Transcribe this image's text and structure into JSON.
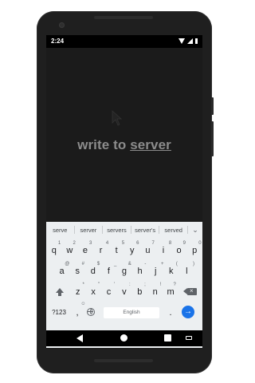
{
  "status": {
    "time": "2:24"
  },
  "app": {
    "text_plain": "write to ",
    "text_underlined": "server"
  },
  "keyboard": {
    "suggestions": [
      "serve",
      "server",
      "servers",
      "server's",
      "served"
    ],
    "row1": [
      {
        "k": "q",
        "h": "1"
      },
      {
        "k": "w",
        "h": "2"
      },
      {
        "k": "e",
        "h": "3"
      },
      {
        "k": "r",
        "h": "4"
      },
      {
        "k": "t",
        "h": "5"
      },
      {
        "k": "y",
        "h": "6"
      },
      {
        "k": "u",
        "h": "7"
      },
      {
        "k": "i",
        "h": "8"
      },
      {
        "k": "o",
        "h": "9"
      },
      {
        "k": "p",
        "h": "0"
      }
    ],
    "row2": [
      {
        "k": "a",
        "h": "@"
      },
      {
        "k": "s",
        "h": "#"
      },
      {
        "k": "d",
        "h": "$"
      },
      {
        "k": "f",
        "h": "_"
      },
      {
        "k": "g",
        "h": "&"
      },
      {
        "k": "h",
        "h": "-"
      },
      {
        "k": "j",
        "h": "+"
      },
      {
        "k": "k",
        "h": "("
      },
      {
        "k": "l",
        "h": ")"
      }
    ],
    "row3": [
      {
        "k": "z",
        "h": "*"
      },
      {
        "k": "x",
        "h": "\""
      },
      {
        "k": "c",
        "h": "'"
      },
      {
        "k": "v",
        "h": ":"
      },
      {
        "k": "b",
        "h": ";"
      },
      {
        "k": "n",
        "h": "!"
      },
      {
        "k": "m",
        "h": "?"
      }
    ],
    "symbols_label": "?123",
    "comma_label": ",",
    "comma_hint": "☺",
    "space_label": "English",
    "period_label": "."
  }
}
